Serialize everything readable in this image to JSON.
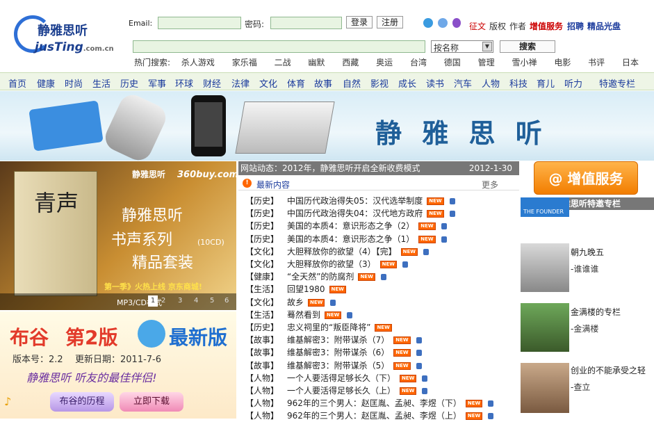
{
  "header": {
    "logo_name": "静雅思听",
    "logo_sub": "jusTing",
    "logo_domain": ".com.cn",
    "email_label": "Email:",
    "password_label": "密码:",
    "login_label": "登录",
    "register_label": "注册",
    "search_select": "按名称",
    "search_button": "搜索",
    "links": [
      "征文",
      "版权",
      "作者",
      "增值服务",
      "招聘",
      "精品光盘"
    ],
    "hot_label": "热门搜索:",
    "hot_terms": [
      "杀人游戏",
      "家乐福",
      "二战",
      "幽默",
      "西藏",
      "奥运",
      "台湾",
      "德国",
      "管理",
      "雪小禅",
      "电影",
      "书评",
      "日本"
    ]
  },
  "nav": [
    "首页",
    "健康",
    "时尚",
    "生活",
    "历史",
    "军事",
    "环球",
    "财经",
    "法律",
    "文化",
    "体育",
    "故事",
    "自然",
    "影视",
    "成长",
    "读书",
    "汽车",
    "人物",
    "科技",
    "育儿",
    "听力",
    "特邀专栏"
  ],
  "banner": {
    "title": "静 雅 思 听"
  },
  "promo1": {
    "book": "青声",
    "headline1": "静雅思听",
    "headline2": "书声系列",
    "headline3": "精品套装",
    "cd": "(10CD)",
    "season": "第一季》火热上线 京东商城!",
    "format": "MP3/CD格式",
    "pages": [
      "1",
      "2",
      "3",
      "4",
      "5",
      "6"
    ],
    "shop": "360buy.com"
  },
  "promo2": {
    "title1": "布谷",
    "title2": "第2版",
    "title3": "最新版",
    "version": "版本号：2.2",
    "date": "更新日期：2011-7-6",
    "slogan": "静雅思听 听友的最佳伴侣!",
    "btn_history": "布谷的历程",
    "btn_download": "立即下载"
  },
  "news": {
    "dynamic": "网站动态：2012年，静雅思听开启全新收费模式",
    "dynamic_date": "2012-1-30",
    "latest": "最新内容",
    "more": "更多",
    "items": [
      {
        "cat": "【历史】",
        "title": "中国历代政治得失05：汉代选举制度",
        "lock": true
      },
      {
        "cat": "【历史】",
        "title": "中国历代政治得失04：汉代地方政府",
        "lock": true
      },
      {
        "cat": "【历史】",
        "title": "美国的本质4：意识形态之争（2）",
        "lock": true
      },
      {
        "cat": "【历史】",
        "title": "美国的本质4：意识形态之争（1）",
        "lock": true
      },
      {
        "cat": "【文化】",
        "title": "大胆释放你的欲望（4）【完】",
        "lock": true
      },
      {
        "cat": "【文化】",
        "title": "大胆释放你的欲望（3）",
        "lock": true
      },
      {
        "cat": "【健康】",
        "title": "“全天然”的防腐剂",
        "lock": true
      },
      {
        "cat": "【生活】",
        "title": "回望1980",
        "lock": false
      },
      {
        "cat": "【文化】",
        "title": "故乡",
        "lock": true
      },
      {
        "cat": "【生活】",
        "title": "蓦然看到",
        "lock": true
      },
      {
        "cat": "【历史】",
        "title": "忠义祠里的“叛臣降将”",
        "lock": false
      },
      {
        "cat": "【故事】",
        "title": "维基解密3：附带谋杀（7）",
        "lock": true
      },
      {
        "cat": "【故事】",
        "title": "维基解密3：附带谋杀（6）",
        "lock": true
      },
      {
        "cat": "【故事】",
        "title": "维基解密3：附带谋杀（5）",
        "lock": true
      },
      {
        "cat": "【人物】",
        "title": "一个人要活得足够长久（下）",
        "lock": true
      },
      {
        "cat": "【人物】",
        "title": "一个人要活得足够长久（上）",
        "lock": true
      },
      {
        "cat": "【人物】",
        "title": "962年的三个男人：赵匡胤、孟昶、李煜（下）",
        "lock": true
      },
      {
        "cat": "【人物】",
        "title": "962年的三个男人：赵匡胤、孟昶、李煜（上）",
        "lock": true
      }
    ],
    "new_badge": "NEW"
  },
  "right": {
    "vas_label": "@ 增值服务",
    "column_head": "静雅思听特邀专栏",
    "cols": [
      {
        "title": "",
        "author": "",
        "img_text": "THE FOUNDER"
      },
      {
        "title": "朝九晚五",
        "author": "-谁谁谁"
      },
      {
        "title": "金满楼的专栏",
        "author": "-金满楼"
      },
      {
        "title": "创业的不能承受之轻",
        "author": "-查立"
      }
    ]
  }
}
